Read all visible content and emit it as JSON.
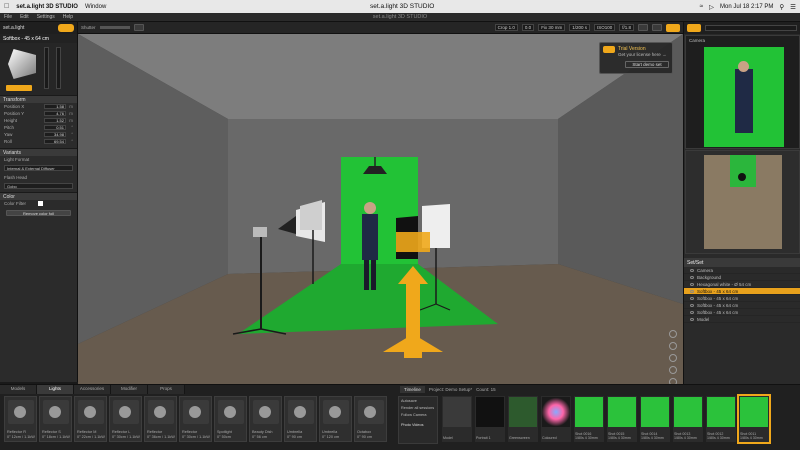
{
  "menubar": {
    "app": "set.a.light 3D STUDIO",
    "window_menu": "Window",
    "title": "set.a.light 3D STUDIO",
    "clock": "Mon Jul 18  2:17 PM"
  },
  "appbar": {
    "title": "set.a.light 3D STUDIO",
    "menu": [
      "File",
      "Edit",
      "Settings",
      "Help"
    ]
  },
  "left": {
    "brand": "set.a.light",
    "selected_title": "Softbox - 45 x 64 cm",
    "sections": {
      "transform": "Transform",
      "variants": "Variants",
      "color": "Color"
    },
    "transform_rows": [
      {
        "label": "Position X",
        "value": "1.58",
        "unit": "m"
      },
      {
        "label": "Position Y",
        "value": "4.76",
        "unit": "m"
      },
      {
        "label": "Height",
        "value": "1.52",
        "unit": "m"
      },
      {
        "label": "Pitch",
        "value": "0.51",
        "unit": "°"
      },
      {
        "label": "Yaw",
        "value": "34.98",
        "unit": "°"
      },
      {
        "label": "Roll",
        "value": "69.54",
        "unit": "°"
      }
    ],
    "light_format_label": "Light Format",
    "light_format_value": "Internal & External Diffuser",
    "flash_head_label": "Flash Head",
    "flash_head_value": "Gobo",
    "color_filter_label": "Color Filter",
    "remove_filter_button": "Remove color foil"
  },
  "toolbar": {
    "shutter_label": "Shutter",
    "crop": "Crop 1.0",
    "ev": "0.0",
    "focal": "Fix 30 mm",
    "speed": "1/200 s",
    "iso": "ISO100",
    "aperture": "f/1.8"
  },
  "viewport": {
    "trial_title": "Trial Version",
    "trial_sub": "Get your license here →",
    "trial_button": "Start demo set"
  },
  "right": {
    "camera_label": "Camera",
    "set_header": "Set/Set",
    "items": [
      {
        "name": "Camera",
        "selected": false
      },
      {
        "name": "Background",
        "selected": false
      },
      {
        "name": "Hexagonal white - Ø 54 cm",
        "selected": false
      },
      {
        "name": "Softbox - 45 x 64 cm",
        "selected": true
      },
      {
        "name": "Softbox - 45 x 64 cm",
        "selected": false
      },
      {
        "name": "Softbox - 45 x 64 cm",
        "selected": false
      },
      {
        "name": "Softbox - 45 x 64 cm",
        "selected": false
      },
      {
        "name": "Model",
        "selected": false
      }
    ]
  },
  "library": {
    "tabs": [
      "Models",
      "Lights",
      "Accessories",
      "Modifier",
      "Props"
    ],
    "active_tab": "Lights",
    "items": [
      "Reflector R\n0° 12cm / 1.1kW",
      "Reflector S\n0° 18cm / 1.1kW",
      "Reflector M\n0° 22cm / 1.1kW",
      "Reflector L\n0° 30cm / 1.1kW",
      "Reflector\n0° 36cm / 1.1kW",
      "Reflector\n0° 30cm / 1.1kW",
      "Spotlight\n0° 50cm",
      "Beauty Dish\n0° 56 cm",
      "Umbrella\n0° 90 cm",
      "Umbrella\n0° 120 cm",
      "Octabox\n0° 90 cm",
      "Octabox\n0° 120 cm"
    ],
    "timeline_tab": "Timeline",
    "project_label": "Project: Demo Setup*",
    "count_label": "Count: 15",
    "timeline_options": [
      "Autosave",
      "Render all sessions",
      "Follow Camera"
    ],
    "photo_videos": "Photo Videos",
    "thumbs": [
      {
        "caption": "Model",
        "color": "#3a3a3a",
        "sel": false
      },
      {
        "caption": "Portrait 1",
        "color": "#111111",
        "sel": false
      },
      {
        "caption": "Greenscreen",
        "color": "#2d5a2d",
        "sel": false
      },
      {
        "caption": "Coloured",
        "color": "#1a1a1a",
        "sel": false
      },
      {
        "caption": "Shot 0016\n1/80s 4 30mm",
        "color": "#2bc23b",
        "sel": false
      },
      {
        "caption": "Shot 0015\n1/80s 4 30mm",
        "color": "#2bc23b",
        "sel": false
      },
      {
        "caption": "Shot 0014\n1/80s 4 30mm",
        "color": "#2bc23b",
        "sel": false
      },
      {
        "caption": "Shot 0013\n1/80s 4 30mm",
        "color": "#2bc23b",
        "sel": false
      },
      {
        "caption": "Shot 0012\n1/80s 4 30mm",
        "color": "#2bc23b",
        "sel": false
      },
      {
        "caption": "Shot 0011\n1/80s 4 30mm",
        "color": "#2bc23b",
        "sel": true
      }
    ]
  },
  "colors": {
    "accent": "#f0a81b",
    "green_screen": "#22c236"
  }
}
